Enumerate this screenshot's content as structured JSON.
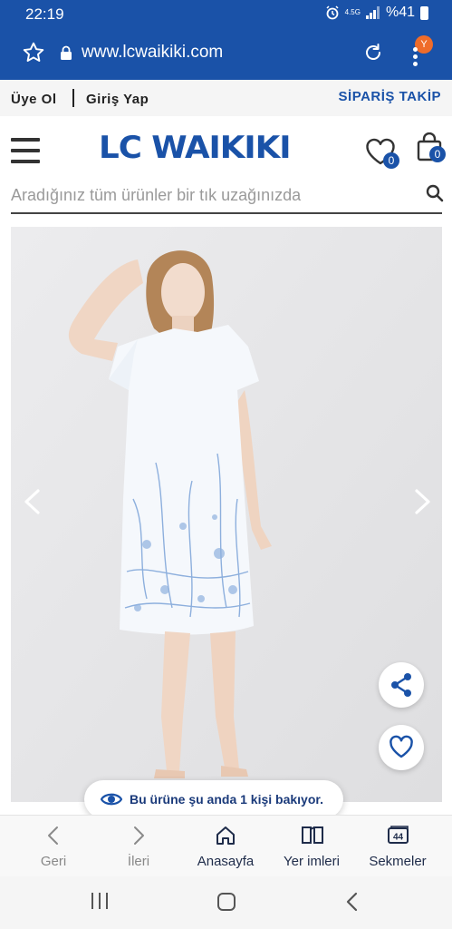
{
  "status": {
    "time": "22:19",
    "network": "4.5G",
    "battery": "%41",
    "colors": {
      "bar": "#1a52a8"
    }
  },
  "browser": {
    "url": "www.lcwaikiki.com",
    "account_initial": "Y",
    "account_badge_color": "#ef6c2a"
  },
  "account": {
    "register": "Üye Ol",
    "login": "Giriş Yap",
    "order_tracking": "SİPARİŞ TAKİP"
  },
  "header": {
    "logo": "LC WAIKIKI",
    "favorites_count": "0",
    "cart_count": "0",
    "brand_color": "#1a52a8"
  },
  "search": {
    "placeholder": "Aradığınız tüm ürünler bir tık uzağınızda",
    "value": ""
  },
  "product": {
    "viewers_notice": "Bu ürüne şu anda 1 kişi bakıyor."
  },
  "toolbar": {
    "items": [
      {
        "label": "Geri",
        "icon": "back-arrow-icon",
        "enabled": false
      },
      {
        "label": "İleri",
        "icon": "forward-arrow-icon",
        "enabled": false
      },
      {
        "label": "Anasayfa",
        "icon": "home-icon",
        "enabled": true
      },
      {
        "label": "Yer imleri",
        "icon": "bookmarks-icon",
        "enabled": true
      },
      {
        "label": "Sekmeler",
        "icon": "tabs-icon",
        "enabled": true,
        "count": "44"
      }
    ]
  }
}
